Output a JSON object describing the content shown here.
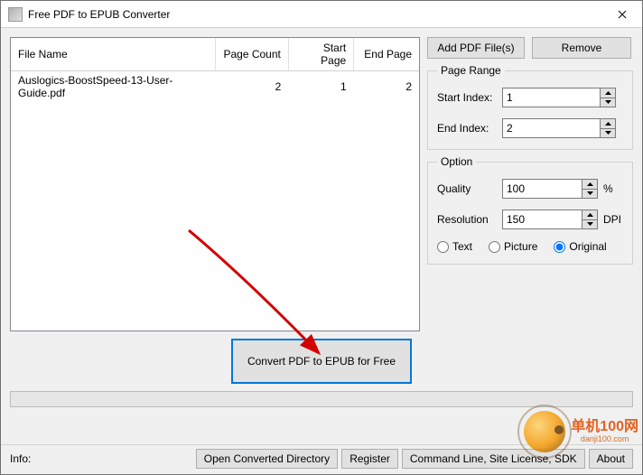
{
  "window": {
    "title": "Free PDF to EPUB Converter"
  },
  "table": {
    "headers": {
      "file_name": "File Name",
      "page_count": "Page Count",
      "start_page": "Start Page",
      "end_page": "End Page"
    },
    "rows": [
      {
        "file_name": "Auslogics-BoostSpeed-13-User-Guide.pdf",
        "page_count": "2",
        "start_page": "1",
        "end_page": "2"
      }
    ]
  },
  "buttons": {
    "add": "Add PDF File(s)",
    "remove": "Remove",
    "convert": "Convert PDF to EPUB for Free",
    "open_dir": "Open Converted Directory",
    "register": "Register",
    "cmdline": "Command Line,  Site License, SDK",
    "about": "About"
  },
  "page_range": {
    "legend": "Page Range",
    "start_label": "Start Index:",
    "start_value": "1",
    "end_label": "End Index:",
    "end_value": "2"
  },
  "option": {
    "legend": "Option",
    "quality_label": "Quality",
    "quality_value": "100",
    "quality_unit": "%",
    "resolution_label": "Resolution",
    "resolution_value": "150",
    "resolution_unit": "DPI",
    "mode_text": "Text",
    "mode_picture": "Picture",
    "mode_original": "Original"
  },
  "footer": {
    "info": "Info:"
  },
  "watermark": {
    "cn": "单机100网",
    "url": "danji100.com"
  }
}
